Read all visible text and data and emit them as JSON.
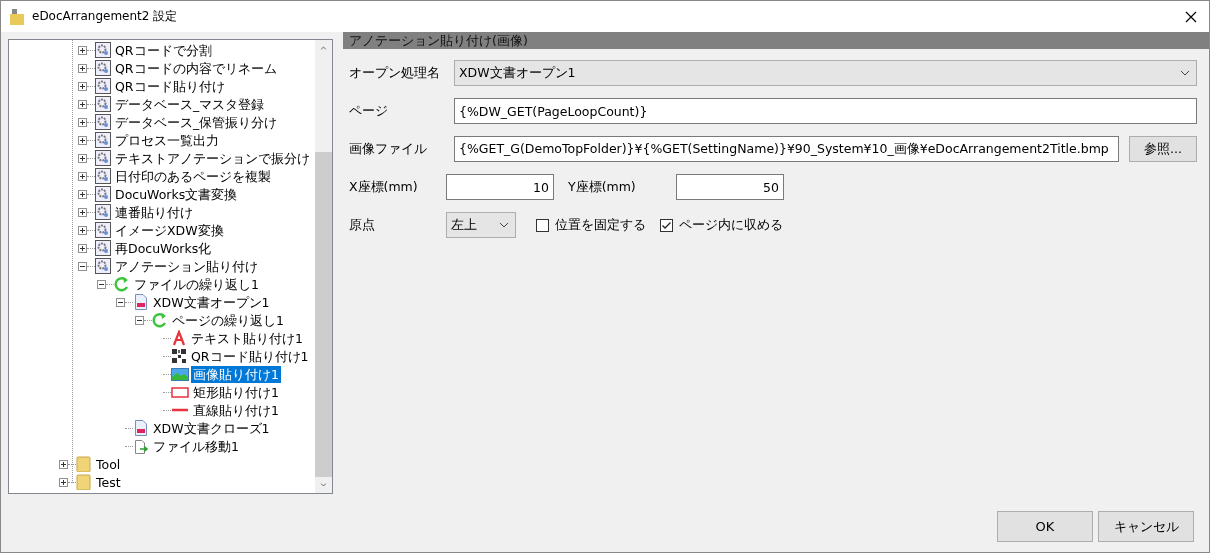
{
  "window": {
    "title": "eDocArrangement2 設定"
  },
  "tree": {
    "items": [
      {
        "children": [
          {
            "label": "QRコードで分割",
            "kind": "gear",
            "expanded": false,
            "selected": false
          },
          {
            "label": "QRコードの内容でリネーム",
            "kind": "gear",
            "expanded": false,
            "selected": false
          },
          {
            "label": "QRコード貼り付け",
            "kind": "gear",
            "expanded": false,
            "selected": false
          },
          {
            "label": "データベース_マスタ登録",
            "kind": "gear",
            "expanded": false,
            "selected": false
          },
          {
            "label": "データベース_保管振り分け",
            "kind": "gear",
            "expanded": false,
            "selected": false
          },
          {
            "label": "プロセス一覧出力",
            "kind": "gear",
            "expanded": false,
            "selected": false
          },
          {
            "label": "テキストアノテーションで振分け",
            "kind": "gear",
            "expanded": false,
            "selected": false
          },
          {
            "label": "日付印のあるページを複製",
            "kind": "gear",
            "expanded": false,
            "selected": false
          },
          {
            "label": "DocuWorks文書変換",
            "kind": "gear",
            "expanded": false,
            "selected": false
          },
          {
            "label": "連番貼り付け",
            "kind": "gear",
            "expanded": false,
            "selected": false
          },
          {
            "label": "イメージXDW変換",
            "kind": "gear",
            "expanded": false,
            "selected": false
          },
          {
            "label": "再DocuWorks化",
            "kind": "gear",
            "expanded": false,
            "selected": false
          },
          {
            "label": "アノテーション貼り付け",
            "kind": "gear",
            "expanded": true,
            "selected": false,
            "children": [
              {
                "label": "ファイルの繰り返し1",
                "kind": "loop",
                "expanded": true,
                "selected": false,
                "children": [
                  {
                    "label": "XDW文書オープン1",
                    "kind": "doc",
                    "expanded": true,
                    "selected": false,
                    "children": [
                      {
                        "label": "ページの繰り返し1",
                        "kind": "loop",
                        "expanded": true,
                        "selected": false,
                        "children": [
                          {
                            "label": "テキスト貼り付け1",
                            "kind": "text",
                            "selected": false
                          },
                          {
                            "label": "QRコード貼り付け1",
                            "kind": "qr",
                            "selected": false
                          },
                          {
                            "label": "画像貼り付け1",
                            "kind": "image",
                            "selected": true
                          },
                          {
                            "label": "矩形貼り付け1",
                            "kind": "rect",
                            "selected": false
                          },
                          {
                            "label": "直線貼り付け1",
                            "kind": "line",
                            "selected": false
                          }
                        ]
                      }
                    ]
                  },
                  {
                    "label": "XDW文書クローズ1",
                    "kind": "doc",
                    "selected": false
                  },
                  {
                    "label": "ファイル移動1",
                    "kind": "move",
                    "selected": false
                  }
                ]
              }
            ]
          }
        ]
      },
      {
        "label": "Tool",
        "kind": "folder",
        "expanded": false,
        "selected": false
      },
      {
        "label": "Test",
        "kind": "folder",
        "expanded": false,
        "selected": false
      }
    ]
  },
  "panel": {
    "title": "アノテーション貼り付け(画像)",
    "fields": [
      {
        "kind": "select",
        "label": "オープン処理名",
        "value": "XDW文書オープン1"
      },
      {
        "kind": "text",
        "label": "ページ",
        "value": "{%DW_GET(PageLoopCount)}"
      },
      {
        "kind": "file",
        "label": "画像ファイル",
        "value": "{%GET_G(DemoTopFolder)}¥{%GET(SettingName)}¥90_System¥10_画像¥eDocArrangement2Title.bmp",
        "button": "参照..."
      }
    ],
    "coords": [
      {
        "label": "X座標(mm)",
        "value": "10"
      },
      {
        "label": "Y座標(mm)",
        "value": "50"
      }
    ],
    "origin": {
      "label": "原点",
      "value": "左上"
    },
    "checkboxes": [
      {
        "label": "位置を固定する",
        "checked": false
      },
      {
        "label": "ページ内に収める",
        "checked": true
      }
    ]
  },
  "buttons": [
    {
      "label": "OK"
    },
    {
      "label": "キャンセル"
    }
  ]
}
